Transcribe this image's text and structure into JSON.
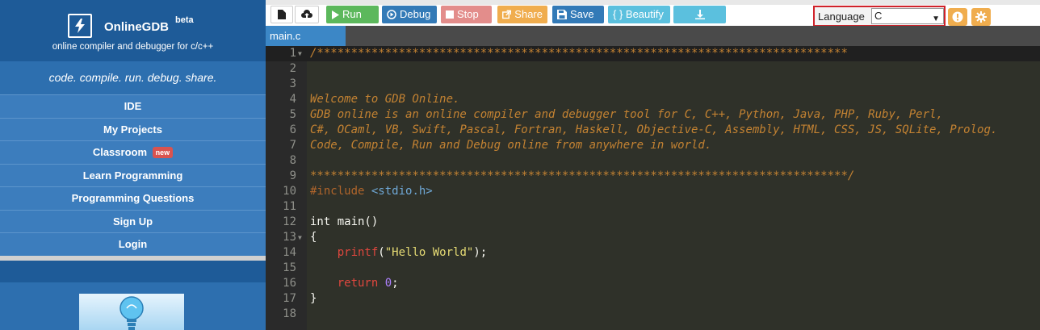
{
  "sidebar": {
    "brand": {
      "name": "OnlineGDB",
      "beta": "beta",
      "subtitle": "online compiler and debugger for c/c++"
    },
    "tagline": "code. compile. run. debug. share.",
    "items": [
      {
        "label": "IDE"
      },
      {
        "label": "My Projects"
      },
      {
        "label": "Classroom",
        "badge": "new"
      },
      {
        "label": "Learn Programming"
      },
      {
        "label": "Programming Questions"
      },
      {
        "label": "Sign Up"
      },
      {
        "label": "Login"
      }
    ]
  },
  "toolbar": {
    "run": "Run",
    "debug": "Debug",
    "stop": "Stop",
    "share": "Share",
    "save": "Save",
    "beautify": "{ } Beautify",
    "language_label": "Language",
    "language_value": "C"
  },
  "tabs": [
    {
      "label": "main.c"
    }
  ],
  "editor": {
    "lines": [
      {
        "n": "1",
        "text": "/******************************************************************************"
      },
      {
        "n": "2",
        "text": ""
      },
      {
        "n": "3",
        "text": ""
      },
      {
        "n": "4",
        "text": "Welcome to GDB Online."
      },
      {
        "n": "4",
        "text": "GDB online is an online compiler and debugger tool for C, C++, Python, Java, PHP, Ruby, Perl,"
      },
      {
        "n": "5",
        "text": "C#, OCaml, VB, Swift, Pascal, Fortran, Haskell, Objective-C, Assembly, HTML, CSS, JS, SQLite, Prolog."
      },
      {
        "n": "6",
        "text": "Code, Compile, Run and Debug online from anywhere in world."
      },
      {
        "n": "7",
        "text": ""
      },
      {
        "n": "8",
        "text": "*******************************************************************************/"
      },
      {
        "n": "9",
        "text": "#include <stdio.h>"
      },
      {
        "n": "10",
        "text": ""
      },
      {
        "n": "11",
        "text": "int main()"
      },
      {
        "n": "12",
        "text": "{"
      },
      {
        "n": "13",
        "text": "    printf(\"Hello World\");"
      },
      {
        "n": "14",
        "text": ""
      },
      {
        "n": "15",
        "text": "    return 0;"
      },
      {
        "n": "16",
        "text": "}"
      },
      {
        "n": "17",
        "text": ""
      }
    ],
    "include_directive": "#include",
    "include_header": "<stdio.h>",
    "printf_fn": "printf",
    "printf_str": "\"Hello World\"",
    "return_kw": "return",
    "return_val": "0"
  },
  "colors": {
    "accent": "#3c87c6",
    "run": "#5cb85c",
    "stop": "#d9534f",
    "warn": "#f0ad4e"
  }
}
